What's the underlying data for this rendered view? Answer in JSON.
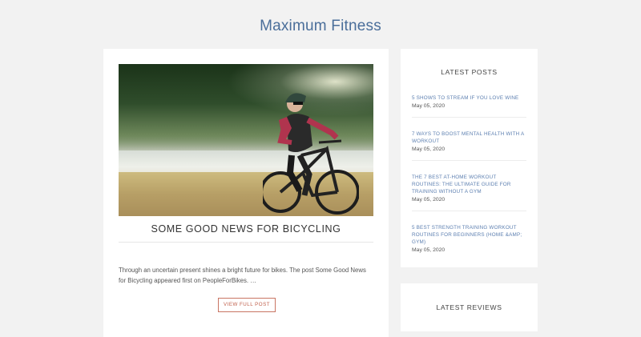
{
  "site": {
    "title": "Maximum Fitness"
  },
  "post": {
    "title": "SOME GOOD NEWS FOR BICYCLING",
    "excerpt": "Through an uncertain present shines a bright future for bikes. The post Some Good News for Bicycling appeared first on PeopleForBikes. …",
    "button_label": "VIEW FULL POST"
  },
  "sidebar": {
    "latest_posts": {
      "heading": "LATEST POSTS",
      "items": [
        {
          "title": "5 SHOWS TO STREAM IF YOU LOVE WINE",
          "date": "May 05, 2020"
        },
        {
          "title": "7 WAYS TO BOOST MENTAL HEALTH WITH A WORKOUT",
          "date": "May 05, 2020"
        },
        {
          "title": "THE 7 BEST AT-HOME WORKOUT ROUTINES: THE ULTIMATE GUIDE FOR TRAINING WITHOUT A GYM",
          "date": "May 05, 2020"
        },
        {
          "title": "5 BEST STRENGTH TRAINING WORKOUT ROUTINES FOR BEGINNERS (HOME &AMP; GYM)",
          "date": "May 05, 2020"
        }
      ]
    },
    "latest_reviews": {
      "heading": "LATEST REVIEWS"
    }
  },
  "colors": {
    "title_blue": "#4a6e9a",
    "link_blue": "#5c7fb0",
    "button_red": "#c0604c"
  }
}
